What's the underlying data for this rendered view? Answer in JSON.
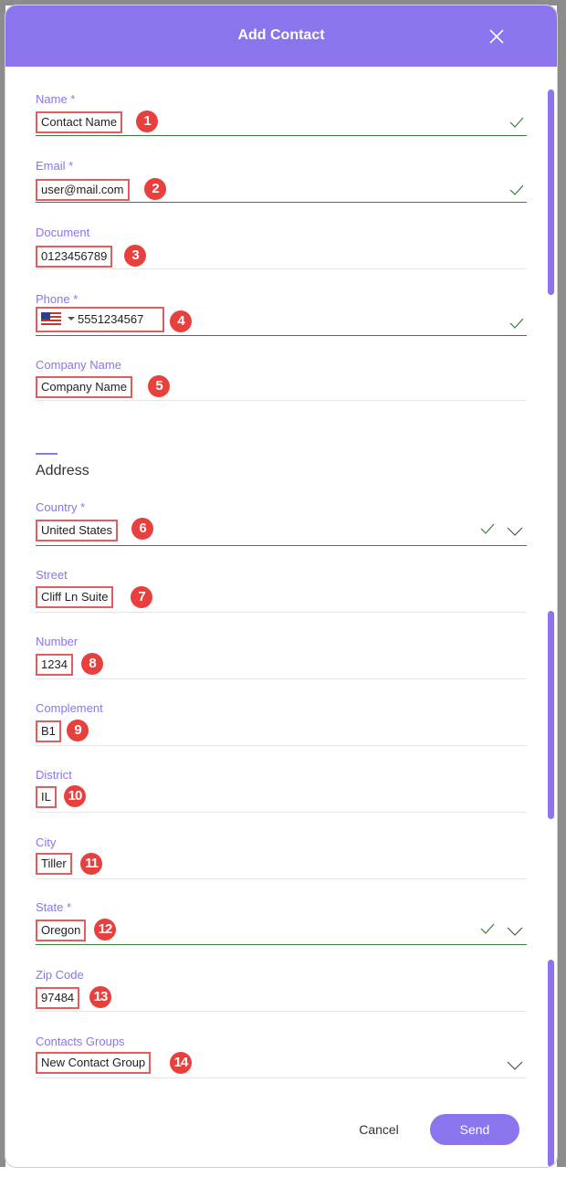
{
  "modal": {
    "title": "Add Contact",
    "close_icon": "close-icon"
  },
  "fields": {
    "name": {
      "label": "Name *",
      "value": "Contact Name",
      "badge": "1"
    },
    "email": {
      "label": "Email *",
      "value": "user@mail.com",
      "badge": "2"
    },
    "document": {
      "label": "Document",
      "value": "0123456789",
      "badge": "3"
    },
    "phone": {
      "label": "Phone *",
      "value": "5551234567",
      "badge": "4",
      "country_icon": "us-flag-icon"
    },
    "company": {
      "label": "Company Name",
      "value": "Company Name",
      "badge": "5"
    }
  },
  "address": {
    "title": "Address",
    "country": {
      "label": "Country *",
      "value": "United States",
      "badge": "6"
    },
    "street": {
      "label": "Street",
      "value": "Cliff Ln Suite",
      "badge": "7"
    },
    "number": {
      "label": "Number",
      "value": "1234",
      "badge": "8"
    },
    "complement": {
      "label": "Complement",
      "value": "B1",
      "badge": "9"
    },
    "district": {
      "label": "District",
      "value": "IL",
      "badge": "10"
    },
    "city": {
      "label": "City",
      "value": "Tiller",
      "badge": "11"
    },
    "state": {
      "label": "State *",
      "value": "Oregon",
      "badge": "12"
    },
    "zip": {
      "label": "Zip Code",
      "value": "97484",
      "badge": "13"
    },
    "groups": {
      "label": "Contacts Groups",
      "value": "New Contact Group",
      "badge": "14"
    }
  },
  "actions": {
    "cancel": "Cancel",
    "send": "Send"
  },
  "colors": {
    "accent": "#8b74ee",
    "valid": "#3b7d3b",
    "highlight": "#e25d5d",
    "badge": "#e8403d"
  }
}
